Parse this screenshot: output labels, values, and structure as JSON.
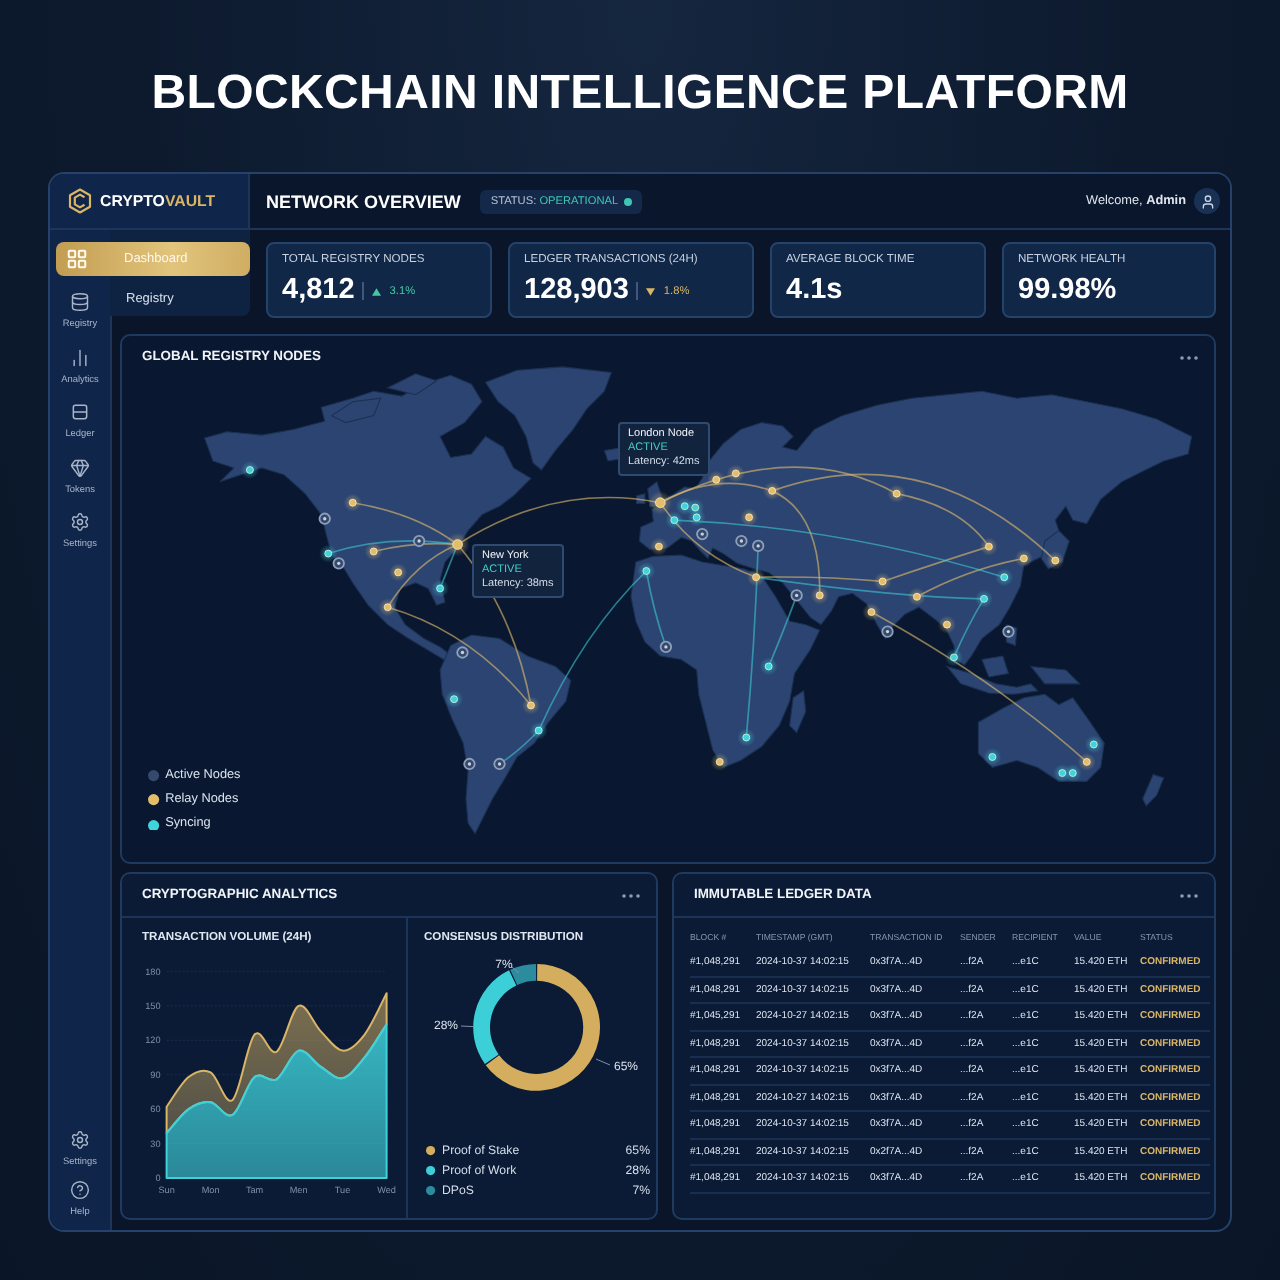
{
  "page_title": "BLOCKCHAIN INTELLIGENCE PLATFORM",
  "brand": {
    "name": "CRYPTO",
    "accent": "VAULT"
  },
  "header": {
    "title": "NETWORK OVERVIEW",
    "status": {
      "label": "STATUS:",
      "value": "OPERATIONAL"
    },
    "welcome": "Welcome, **Admin**"
  },
  "sidebar": {
    "menu": [
      {
        "label": "Dashboard",
        "selected": true
      },
      {
        "label": "Registry",
        "selected": false
      }
    ],
    "items": [
      {
        "label": "Registry"
      },
      {
        "label": "Analytics"
      },
      {
        "label": "Ledger"
      },
      {
        "label": "Tokens"
      },
      {
        "label": "Settings"
      }
    ],
    "footer_items": [
      {
        "label": "Settings"
      },
      {
        "label": "Help"
      }
    ]
  },
  "stats": [
    {
      "label": "TOTAL REGISTRY NODES",
      "value": "4,812",
      "trend": {
        "up": true,
        "change": "3.1%"
      }
    },
    {
      "label": "LEDGER TRANSACTIONS (24H)",
      "value": "128,903",
      "trend": {
        "up": false,
        "change": "1.8%"
      }
    },
    {
      "label": "AVERAGE BLOCK TIME",
      "value": "4.1s"
    },
    {
      "label": "NETWORK HEALTH",
      "value": "99.98%"
    }
  ],
  "map": {
    "title": "GLOBAL REGISTRY NODES",
    "tooltips": [
      {
        "name": "London Node",
        "status": "ACTIVE",
        "latency": "Latency: 42ms"
      },
      {
        "name": "New York",
        "status": "ACTIVE",
        "latency": "Latency: 38ms"
      }
    ],
    "legend": [
      {
        "label": "Active Nodes",
        "color": "#34496b"
      },
      {
        "label": "Relay Nodes",
        "color": "#e3bd6a"
      },
      {
        "label": "Syncing",
        "color": "#3fd3dc"
      }
    ]
  },
  "analytics": {
    "title": "CRYPTOGRAPHIC ANALYTICS",
    "volume": {
      "chart_data": {
        "type": "area",
        "title": "TRANSACTION VOLUME (24H)",
        "categories": [
          "Sun",
          null,
          "Mon",
          null,
          "Tam",
          null,
          "Men",
          null,
          "Tue",
          null,
          "Wed"
        ],
        "ylim": [
          0,
          180
        ],
        "yticks": [
          0,
          30,
          60,
          90,
          120,
          150,
          180
        ],
        "grid": true,
        "stacked": true,
        "series": [
          {
            "color": "#3fd1da",
            "values": [
              39,
              60,
              66,
              55,
              88,
              86,
              111,
              97,
              87,
              105,
              134
            ]
          },
          {
            "color": "#d9b566",
            "values": [
              23,
              28,
              26,
              13,
              37,
              24,
              39,
              31,
              24,
              20,
              27
            ]
          }
        ]
      }
    },
    "consensus": {
      "chart_data": {
        "type": "donut",
        "title": "CONSENSUS DISTRIBUTION",
        "categories": [
          "Proof of Stake",
          "Proof of Work",
          "DPoS"
        ],
        "values": [
          65,
          28,
          7
        ],
        "value_labels": [
          "65%",
          "28%",
          "7%"
        ]
      },
      "legend": [
        {
          "share": "65%",
          "color": "#d4ae5e"
        },
        {
          "share": "28%",
          "color": "#3ccfd8"
        },
        {
          "share": "7%",
          "color": "#2b8c9e"
        }
      ]
    }
  },
  "ledger": {
    "title": "IMMUTABLE LEDGER DATA",
    "columns": [
      "BLOCK #",
      "TIMESTAMP (GMT)",
      "TRANSACTION ID",
      "SENDER",
      "RECIPIENT",
      "VALUE",
      "STATUS"
    ],
    "rows": [
      [
        "#1,048,291",
        "2024-10-37 14:02:15",
        "0x3f7A...4D",
        "...f2A",
        "...e1C",
        "15.420 ETH",
        "CONFIRMED"
      ],
      [
        "#1,048,291",
        "2024-10-37 14:02:15",
        "0x3f7A...4D",
        "...f2A",
        "...e1C",
        "15.420 ETH",
        "CONFIRMED"
      ],
      [
        "#1,045,291",
        "2024-10-27 14:02:15",
        "0x3f7A...4D",
        "...f2A",
        "...e1C",
        "15.420 ETH",
        "CONFIRMED"
      ],
      [
        "#1,048,291",
        "2024-10-37 14:02:15",
        "0x3f7A...4D",
        "...f2A",
        "...e1C",
        "15.420 ETH",
        "CONFIRMED"
      ],
      [
        "#1,048,291",
        "2024-10-37 14:02:15",
        "0x3f7A...4D",
        "...f2A",
        "...e1C",
        "15.420 ETH",
        "CONFIRMED"
      ],
      [
        "#1,048,291",
        "2024-10-27 14:02:15",
        "0x3f7A...4D",
        "...f2A",
        "...e1C",
        "15.420 ETH",
        "CONFIRMED"
      ],
      [
        "#1,048,291",
        "2024-10-37 14:02:15",
        "0x3f7A...4D",
        "...f2A",
        "...e1C",
        "15.420 ETH",
        "CONFIRMED"
      ],
      [
        "#1,048,291",
        "2024-10-37 14:02:15",
        "0x2f7A...4D",
        "...f2A",
        "...e1C",
        "15.420 ETH",
        "CONFIRMED"
      ],
      [
        "#1,048,291",
        "2024-10-37 14:02:15",
        "0x3f7A...4D",
        "...f2A",
        "...e1C",
        "15.420 ETH",
        "CONFIRMED"
      ]
    ]
  }
}
